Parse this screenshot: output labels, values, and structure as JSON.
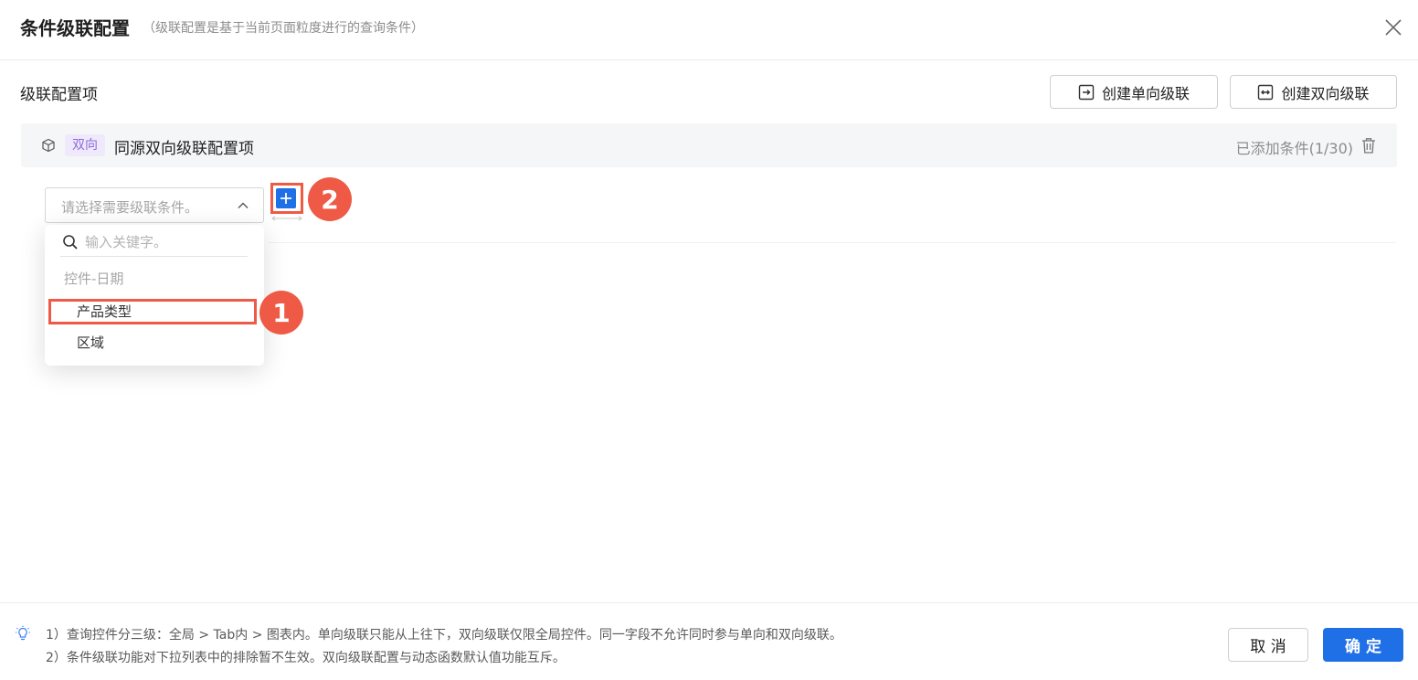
{
  "dialog": {
    "title": "条件级联配置",
    "subtitle": "（级联配置是基于当前页面粒度进行的查询条件）",
    "close_icon": "close-icon"
  },
  "section": {
    "title": "级联配置项",
    "create_oneway_label": "创建单向级联",
    "create_twoway_label": "创建双向级联"
  },
  "config_item": {
    "tag": "双向",
    "name": "同源双向级联配置项",
    "count_text": "已添加条件(1/30)",
    "tag_color": "#8d6be0"
  },
  "condition_select": {
    "placeholder": "请选择需要级联条件。"
  },
  "dropdown": {
    "search_placeholder": "输入关键字。",
    "group_label": "控件-日期",
    "items": [
      {
        "label": "产品类型"
      },
      {
        "label": "区域"
      }
    ]
  },
  "annotations": {
    "badge_1": "1",
    "badge_2": "2",
    "highlight_color": "#ee5a45"
  },
  "footer": {
    "notes": [
      "1）查询控件分三级：全局 > Tab内 > 图表内。单向级联只能从上往下，双向级联仅限全局控件。同一字段不允许同时参与单向和双向级联。",
      "2）条件级联功能对下拉列表中的排除暂不生效。双向级联配置与动态函数默认值功能互斥。"
    ],
    "cancel_label": "取 消",
    "confirm_label": "确 定",
    "primary_color": "#1f6fe6"
  }
}
